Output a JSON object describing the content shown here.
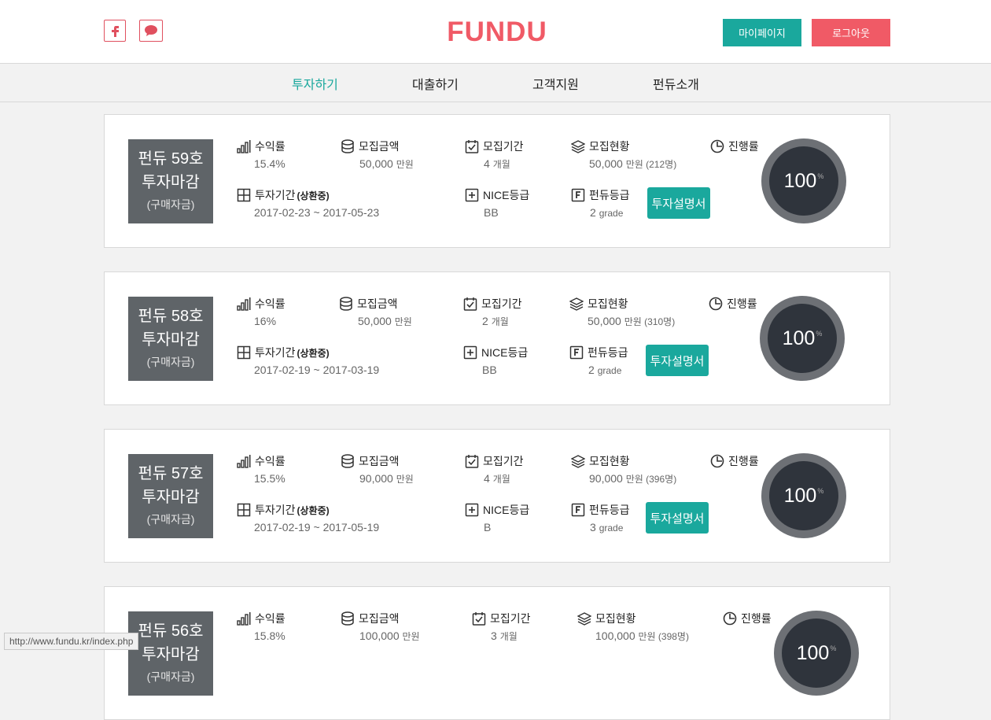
{
  "header": {
    "logo_text": "FUNDU",
    "mypage_label": "마이페이지",
    "logout_label": "로그아웃",
    "brand_color": "#f05a66",
    "accent_color": "#1aa89d"
  },
  "nav": {
    "items": [
      "투자하기",
      "대출하기",
      "고객지원",
      "펀듀소개"
    ],
    "active": "투자하기"
  },
  "labels": {
    "rate": "수익률",
    "amount": "모집금액",
    "period": "모집기간",
    "status": "모집현황",
    "progress": "진행률",
    "invest_period": "투자기간",
    "repay_tag": "(상환중)",
    "nice": "NICE등급",
    "fundu": "펀듀등급",
    "doc_button": "투자설명서",
    "unit_man": "만원",
    "unit_month": "개월",
    "unit_grade": "grade",
    "pct_mark": "%"
  },
  "products": [
    {
      "title": "펀듀 59호",
      "state": "투자마감",
      "category": "(구매자금)",
      "rate": "15.4%",
      "amount": "50,000",
      "period_months": "4",
      "status_amount": "50,000",
      "status_people": "(212명)",
      "progress": "100",
      "invest_period": "2017-02-23 ~ 2017-05-23",
      "nice": "BB",
      "fundu_grade": "2"
    },
    {
      "title": "펀듀 58호",
      "state": "투자마감",
      "category": "(구매자금)",
      "rate": "16%",
      "amount": "50,000",
      "period_months": "2",
      "status_amount": "50,000",
      "status_people": "(310명)",
      "progress": "100",
      "invest_period": "2017-02-19 ~ 2017-03-19",
      "nice": "BB",
      "fundu_grade": "2"
    },
    {
      "title": "펀듀 57호",
      "state": "투자마감",
      "category": "(구매자금)",
      "rate": "15.5%",
      "amount": "90,000",
      "period_months": "4",
      "status_amount": "90,000",
      "status_people": "(396명)",
      "progress": "100",
      "invest_period": "2017-02-19 ~ 2017-05-19",
      "nice": "B",
      "fundu_grade": "3"
    },
    {
      "title": "펀듀 56호",
      "state": "투자마감",
      "category": "(구매자금)",
      "rate": "15.8%",
      "amount": "100,000",
      "period_months": "3",
      "status_amount": "100,000",
      "status_people": "(398명)",
      "progress": "100",
      "invest_period": "",
      "nice": "",
      "fundu_grade": ""
    }
  ],
  "status_url": "http://www.fundu.kr/index.php"
}
